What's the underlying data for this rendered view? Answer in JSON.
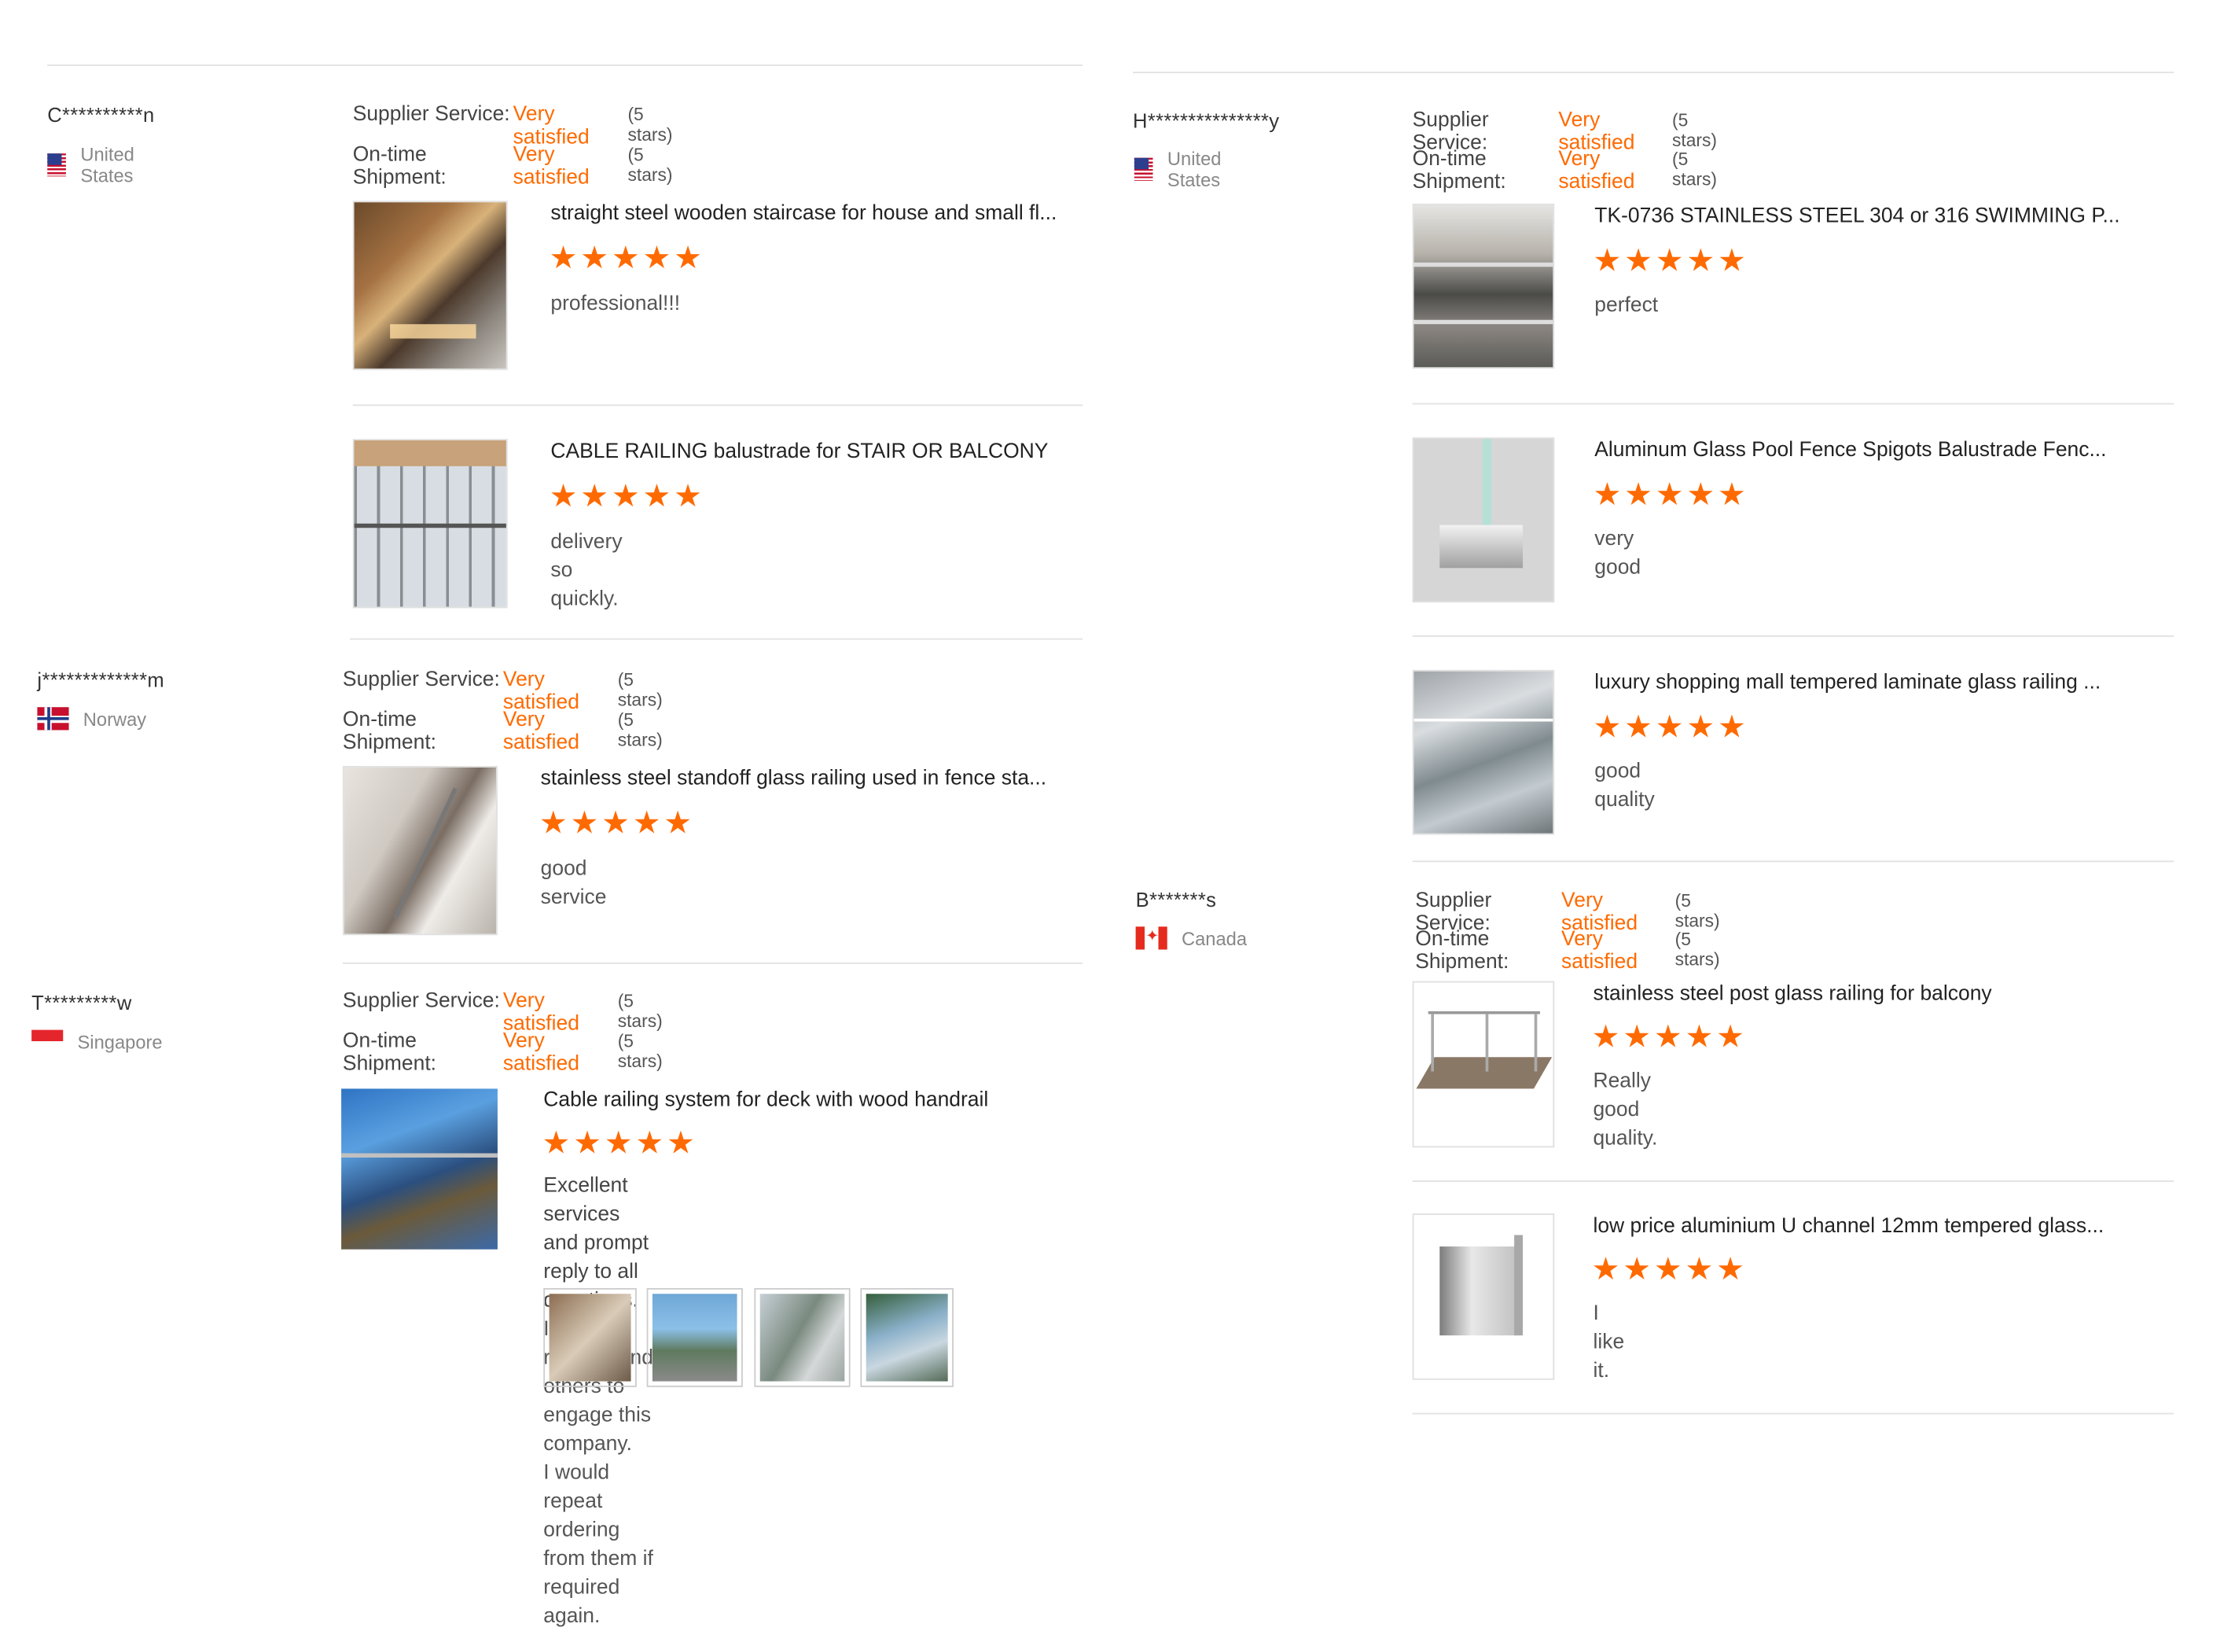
{
  "labels": {
    "supplier_service": "Supplier Service:",
    "ontime_shipment": "On-time Shipment:"
  },
  "colors": {
    "accent": "#ff6a00"
  },
  "reviews": [
    {
      "user": "C**********n",
      "country": "United States",
      "flag": "us-flag",
      "supplier_service": "Very satisfied",
      "supplier_stars": "(5 stars)",
      "shipment": "Very satisfied",
      "shipment_stars": "(5 stars)",
      "items": [
        {
          "title": "straight steel wooden staircase for house and small fl...",
          "stars": "★★★★★",
          "rating": 5,
          "comment": "professional!!!"
        },
        {
          "title": "CABLE RAILING balustrade for STAIR OR BALCONY",
          "stars": "★★★★★",
          "rating": 5,
          "comment": "delivery so quickly."
        }
      ]
    },
    {
      "user": "j*************m",
      "country": "Norway",
      "flag": "norway-flag",
      "supplier_service": "Very satisfied",
      "supplier_stars": "(5 stars)",
      "shipment": "Very satisfied",
      "shipment_stars": "(5 stars)",
      "items": [
        {
          "title": "stainless steel standoff glass railing used in fence sta...",
          "stars": "★★★★★",
          "rating": 5,
          "comment": "good service"
        }
      ]
    },
    {
      "user": "T*********w",
      "country": "Singapore",
      "flag": "singapore-flag",
      "supplier_service": "Very satisfied",
      "supplier_stars": "(5 stars)",
      "shipment": "Very satisfied",
      "shipment_stars": "(5 stars)",
      "items": [
        {
          "title": "Cable railing system for deck with wood handrail",
          "stars": "★★★★★",
          "rating": 5,
          "comment_lines": [
            "Excellent services and prompt reply to all questions.",
            "I would recommend others to engage this company.",
            "I would repeat ordering from them if required again."
          ]
        }
      ]
    },
    {
      "user": "H***************y",
      "country": "United States",
      "flag": "us-flag",
      "supplier_service": "Very satisfied",
      "supplier_stars": "(5 stars)",
      "shipment": "Very satisfied",
      "shipment_stars": "(5 stars)",
      "items": [
        {
          "title": "TK-0736 STAINLESS STEEL 304 or 316 SWIMMING P...",
          "stars": "★★★★★",
          "rating": 5,
          "comment": "perfect"
        },
        {
          "title": "Aluminum Glass Pool Fence Spigots Balustrade Fenc...",
          "stars": "★★★★★",
          "rating": 5,
          "comment": "very good"
        },
        {
          "title": "luxury shopping mall tempered laminate glass railing ...",
          "stars": "★★★★★",
          "rating": 5,
          "comment": "good quality"
        }
      ]
    },
    {
      "user": "B*******s",
      "country": "Canada",
      "flag": "canada-flag",
      "supplier_service": "Very satisfied",
      "supplier_stars": "(5 stars)",
      "shipment": "Very satisfied",
      "shipment_stars": "(5 stars)",
      "items": [
        {
          "title": "stainless steel post glass railing for balcony",
          "stars": "★★★★★",
          "rating": 5,
          "comment": "Really good quality."
        },
        {
          "title": "low price aluminium U channel 12mm tempered glass...",
          "stars": "★★★★★",
          "rating": 5,
          "comment": "I like it."
        }
      ]
    }
  ]
}
